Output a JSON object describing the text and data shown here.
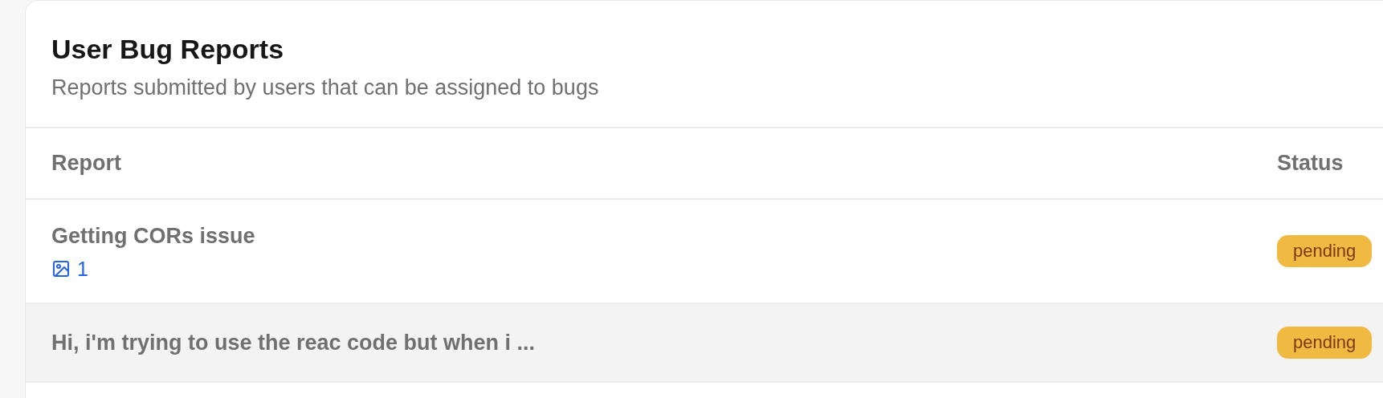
{
  "card": {
    "title": "User Bug Reports",
    "subtitle": "Reports submitted by users that can be assigned to bugs"
  },
  "table": {
    "columns": [
      "Report",
      "Status"
    ],
    "rows": [
      {
        "report": "Getting CORs issue",
        "attachments": "1",
        "status": "pending",
        "highlighted": false
      },
      {
        "report": "Hi, i'm trying to use the reac code but when i ...",
        "status": "pending",
        "highlighted": true
      }
    ]
  }
}
